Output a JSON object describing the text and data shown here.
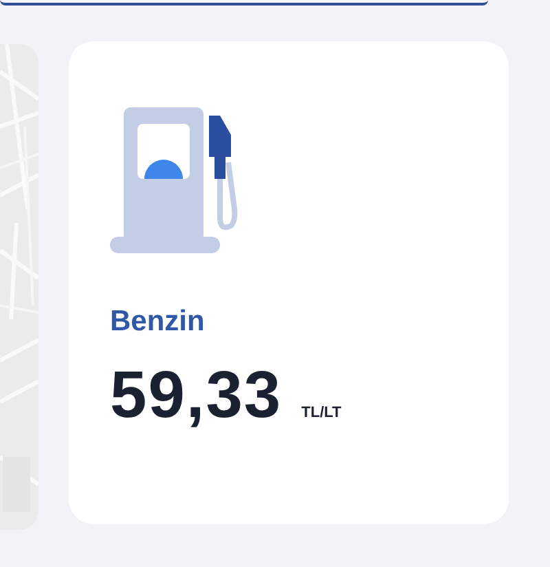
{
  "fuel_card": {
    "name": "Benzin",
    "price": "59,33",
    "unit": "TL/LT"
  }
}
